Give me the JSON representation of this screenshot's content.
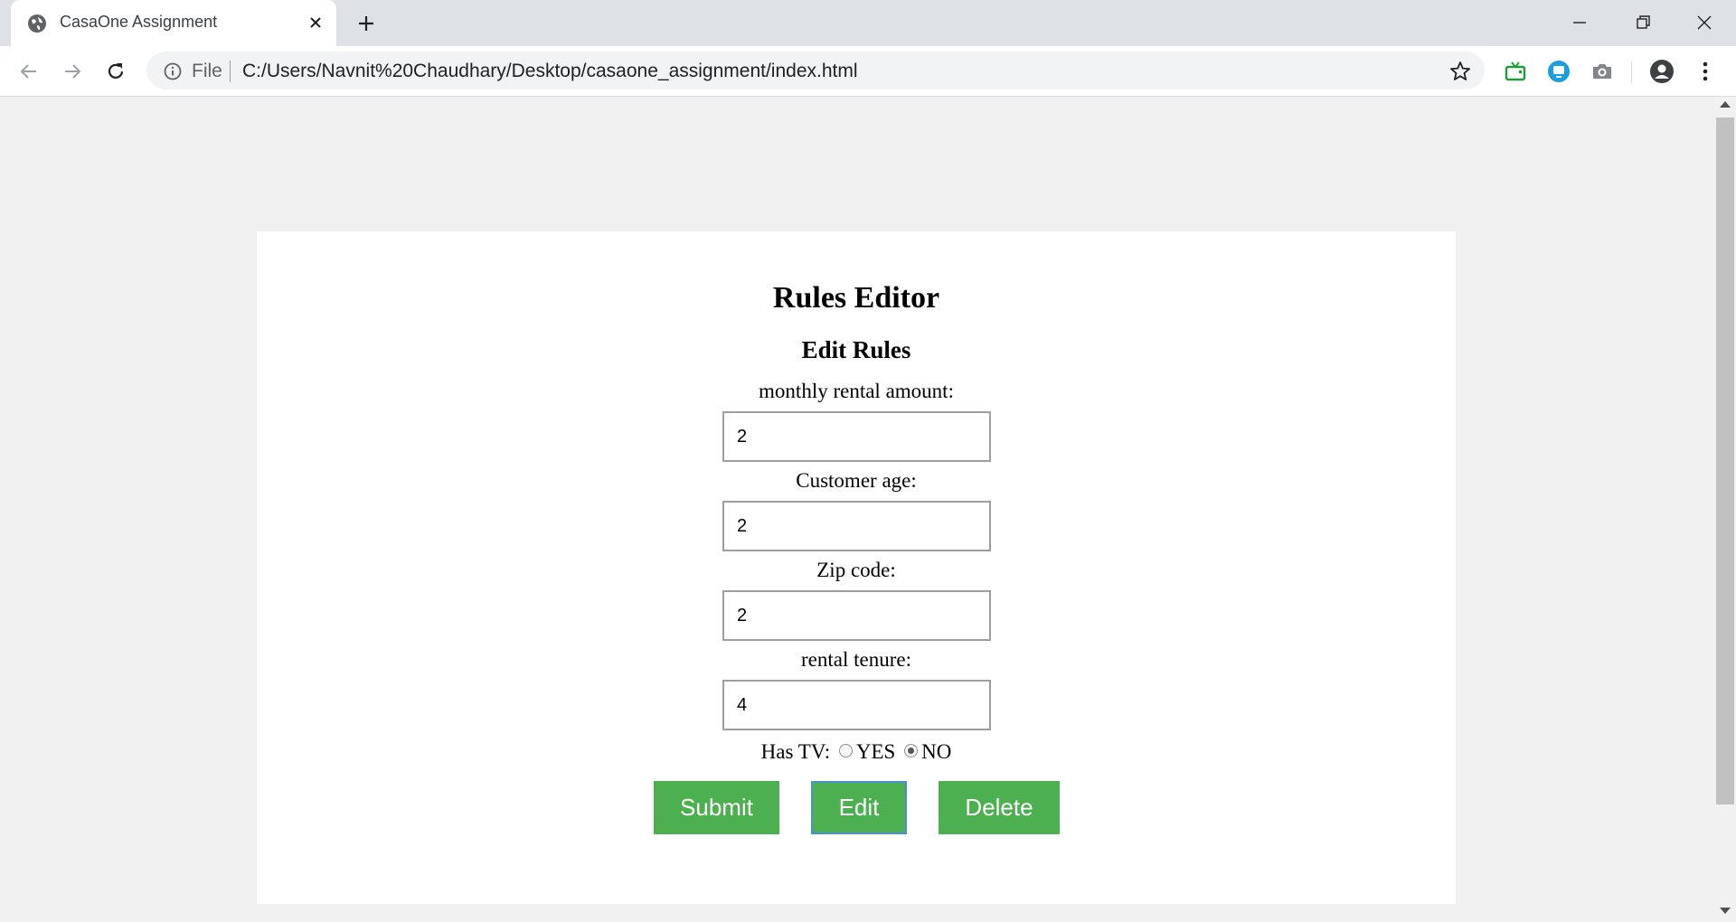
{
  "browser": {
    "tab_title": "CasaOne Assignment",
    "file_label": "File",
    "url": "C:/Users/Navnit%20Chaudhary/Desktop/casaone_assignment/index.html"
  },
  "page": {
    "title": "Rules Editor",
    "subtitle": "Edit Rules",
    "fields": [
      {
        "label": "monthly rental amount:",
        "value": "2"
      },
      {
        "label": "Customer age:",
        "value": "2"
      },
      {
        "label": "Zip code:",
        "value": "2"
      },
      {
        "label": "rental tenure:",
        "value": "4"
      }
    ],
    "has_tv": {
      "label": "Has TV:",
      "options": [
        "YES",
        "NO"
      ],
      "selected": "NO"
    },
    "buttons": {
      "submit": "Submit",
      "edit": "Edit",
      "delete": "Delete"
    }
  },
  "colors": {
    "button_green": "#4caf50",
    "card_background": "#ffffff",
    "page_background": "#f0f0f0"
  }
}
